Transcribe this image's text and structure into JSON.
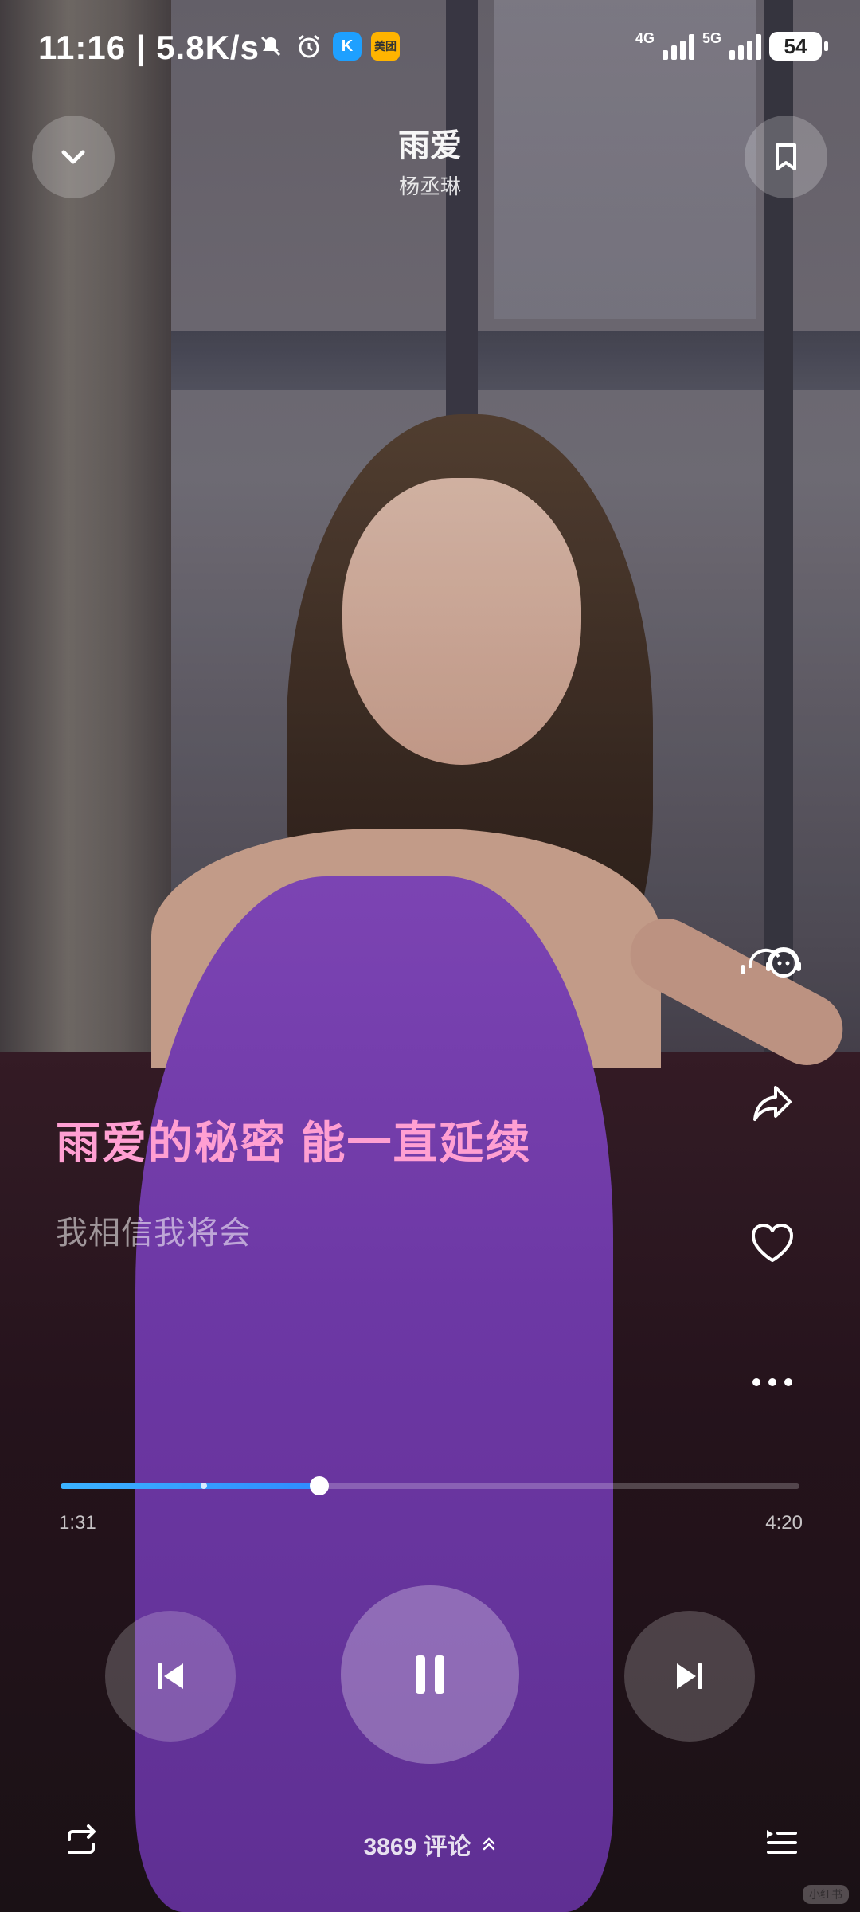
{
  "status_bar": {
    "time": "11:16",
    "network_speed": "| 5.8K/s",
    "icons": [
      "mute-bell-icon",
      "alarm-icon",
      "k-app-icon",
      "meituan-icon"
    ],
    "k_label": "K",
    "meituan_label": "美团",
    "net1": "4G",
    "net2": "5G",
    "battery": "54"
  },
  "header": {
    "song_title": "雨爱",
    "artist": "杨丞琳"
  },
  "lyrics": {
    "current": "雨爱的秘密 能一直延续",
    "next": "我相信我将会"
  },
  "progress": {
    "elapsed": "1:31",
    "total": "4:20",
    "fraction": 0.35,
    "buffered_fraction": 0.19
  },
  "comments": {
    "label": "3869 评论"
  },
  "side_actions": [
    "listen-together-icon",
    "share-icon",
    "like-heart-icon",
    "more-icon"
  ],
  "watermark": "小红书",
  "colors": {
    "lyric_active": "#ff9fd2",
    "progress": "#3bb3ff"
  }
}
